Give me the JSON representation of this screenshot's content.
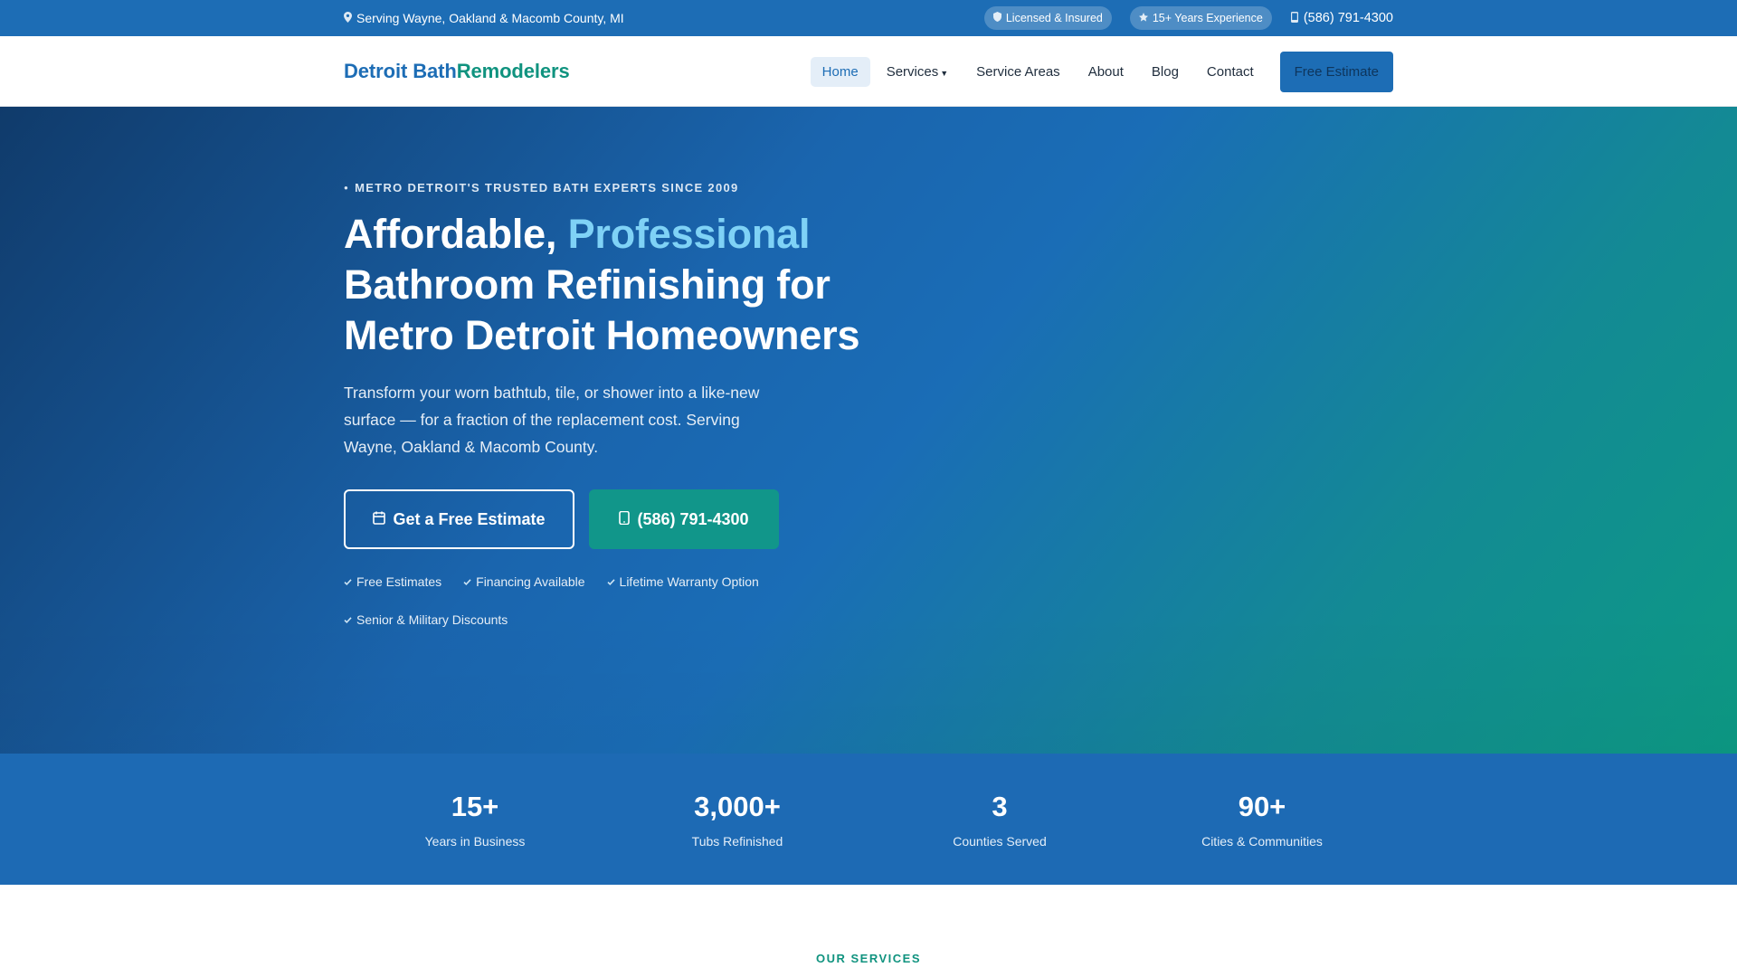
{
  "topbar": {
    "service_area": "Serving Wayne, Oakland & Macomb County, MI",
    "badges": [
      "Licensed & Insured",
      "15+ Years Experience"
    ],
    "phone": "(586) 791-4300"
  },
  "nav": {
    "logo_part1": "Detroit Bath",
    "logo_part2": "Remodelers",
    "items": [
      "Home",
      "Services",
      "Service Areas",
      "About",
      "Blog",
      "Contact"
    ],
    "cta": "Free Estimate"
  },
  "hero": {
    "eyebrow": "METRO DETROIT'S TRUSTED BATH EXPERTS SINCE 2009",
    "headline_pre": "Affordable, ",
    "headline_accent": "Professional",
    "headline_rest": "Bathroom Refinishing for Metro Detroit Homeowners",
    "subtext": "Transform your worn bathtub, tile, or shower into a like-new surface — for a fraction of the replacement cost. Serving Wayne, Oakland & Macomb County.",
    "cta_primary": "Get a Free Estimate",
    "cta_phone": "(586) 791-4300",
    "perks": [
      "Free Estimates",
      "Financing Available",
      "Lifetime Warranty Option",
      "Senior & Military Discounts"
    ]
  },
  "stats": [
    {
      "value": "15+",
      "label": "Years in Business"
    },
    {
      "value": "3,000+",
      "label": "Tubs Refinished"
    },
    {
      "value": "3",
      "label": "Counties Served"
    },
    {
      "value": "90+",
      "label": "Cities & Communities"
    }
  ],
  "services": {
    "kicker": "OUR SERVICES"
  },
  "icons": {
    "location": "map-pin-icon",
    "shield": "shield-icon",
    "star": "star-icon",
    "phone": "phone-icon",
    "calendar": "calendar-icon",
    "check": "check-icon"
  },
  "colors": {
    "primary": "#1d6db5",
    "accent_teal": "#10937f",
    "headline_accent": "#7fd2f6"
  }
}
